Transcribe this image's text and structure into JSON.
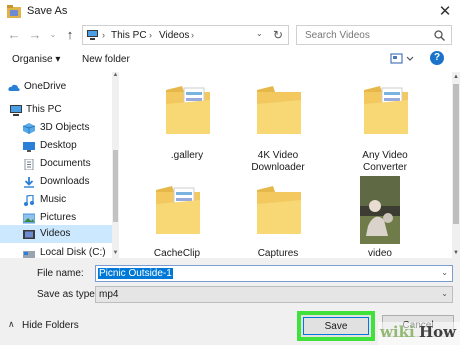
{
  "window": {
    "title": "Save As",
    "close": "✕"
  },
  "nav": {
    "back": "←",
    "forward": "→",
    "up": "↑",
    "recent": "⌄",
    "breadcrumb": [
      "This PC",
      "Videos"
    ],
    "search_placeholder": "Search Videos"
  },
  "toolbar": {
    "organise": "Organise ▾",
    "new_folder": "New folder",
    "help": "?"
  },
  "sidebar": {
    "items": [
      {
        "label": "OneDrive",
        "icon": "cloud-icon"
      },
      {
        "label": "This PC",
        "icon": "computer-icon"
      },
      {
        "label": "3D Objects",
        "icon": "cube-icon"
      },
      {
        "label": "Desktop",
        "icon": "desktop-icon"
      },
      {
        "label": "Documents",
        "icon": "documents-icon"
      },
      {
        "label": "Downloads",
        "icon": "download-icon"
      },
      {
        "label": "Music",
        "icon": "music-icon"
      },
      {
        "label": "Pictures",
        "icon": "pictures-icon"
      },
      {
        "label": "Videos",
        "icon": "videos-icon",
        "selected": true
      },
      {
        "label": "Local Disk (C:)",
        "icon": "disk-icon"
      }
    ]
  },
  "files": [
    {
      "name": ".gallery",
      "type": "folder-with-docs"
    },
    {
      "name": "4K Video Downloader",
      "type": "folder"
    },
    {
      "name": "Any Video Converter",
      "type": "folder-with-docs"
    },
    {
      "name": "CacheClip",
      "type": "folder-with-docs"
    },
    {
      "name": "Captures",
      "type": "folder"
    },
    {
      "name": "video",
      "type": "video-thumbnail"
    }
  ],
  "form": {
    "file_name_label": "File name:",
    "file_name_value": "Picnic Outside-1",
    "save_type_label": "Save as type:",
    "save_type_value": "mp4"
  },
  "footer": {
    "hide_folders": "Hide Folders",
    "save": "Save",
    "cancel": "Cancel"
  },
  "watermark": {
    "wiki": "wiki",
    "how": "How"
  },
  "colors": {
    "accent": "#0078d7",
    "highlight": "#3fe13a",
    "folder": "#f8d775",
    "selected_nav": "#cce8ff"
  }
}
